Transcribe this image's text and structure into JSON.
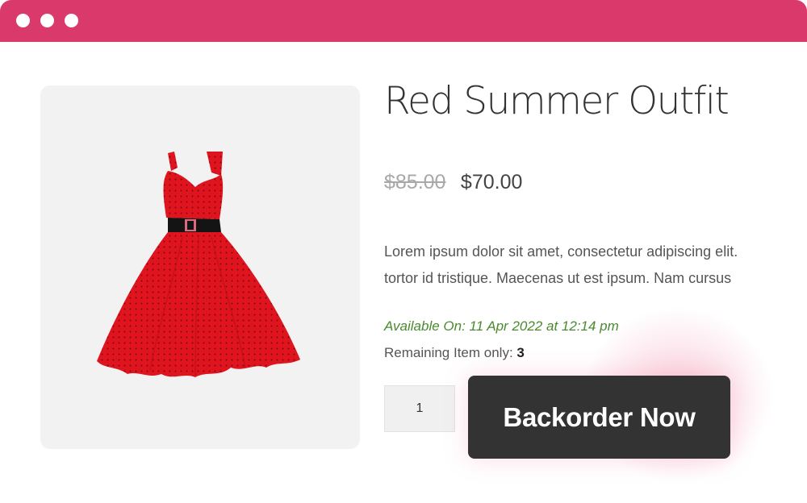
{
  "window": {
    "titlebar_color": "#d93a6b",
    "controls": [
      "window-dot",
      "window-dot",
      "window-dot"
    ]
  },
  "product": {
    "title": "Red Summer Outfit",
    "price_original": "$85.00",
    "price_sale": "$70.00",
    "description_lines": [
      "Lorem ipsum dolor sit amet, consectetur adipiscing elit.",
      "tortor id tristique. Maecenas ut est ipsum. Nam cursus"
    ],
    "availability": "Available On: 11 Apr 2022 at 12:14 pm",
    "remaining_label": "Remaining Item only:",
    "remaining_count": "3",
    "quantity": "1",
    "cta_label": "Backorder Now",
    "image": "red-polka-dot-dress-image"
  },
  "colors": {
    "accent": "#d93a6b",
    "availability_text": "#4a8a2e",
    "cta_background": "#333333"
  }
}
